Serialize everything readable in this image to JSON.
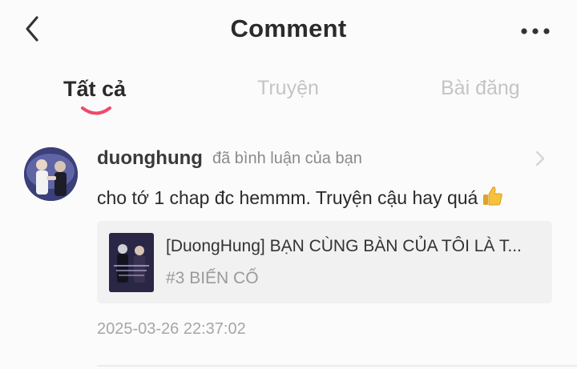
{
  "header": {
    "title": "Comment",
    "back_icon": "chevron-left-icon",
    "more_icon": "more-dots-icon"
  },
  "tabs": [
    {
      "label": "Tất cả",
      "active": true
    },
    {
      "label": "Truyện",
      "active": false
    },
    {
      "label": "Bài đăng",
      "active": false
    }
  ],
  "colors": {
    "accent": "#ee4a6b",
    "inactive_tab": "#c4c4c4",
    "meta_text": "#a6a6a6"
  },
  "notification": {
    "username": "duonghung",
    "action": "đã bình luận của bạn",
    "comment": "cho tớ 1 chap đc hemmm. Truyện cậu hay quá",
    "comment_emoji": "thumbs-up-emoji",
    "story": {
      "title": "[DuongHung] BẠN CÙNG BÀN CỦA TÔI LÀ T...",
      "chapter": "#3 BIẾN CỐ"
    },
    "timestamp": "2025-03-26 22:37:02"
  }
}
